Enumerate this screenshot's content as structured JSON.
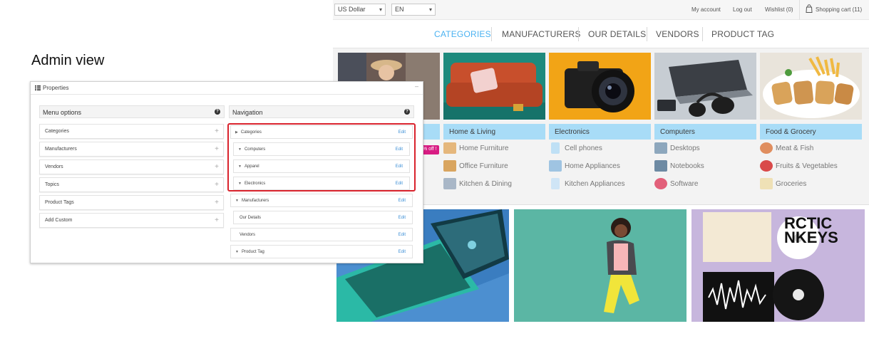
{
  "store": {
    "topbar": {
      "currency": "US Dollar",
      "language": "EN",
      "links": [
        "My account",
        "Log out",
        "Wishlist (0)",
        "Shopping cart (11)"
      ]
    },
    "nav": {
      "items": [
        "CATEGORIES",
        "MANUFACTURERS",
        "OUR DETAILS",
        "VENDORS",
        "PRODUCT TAG"
      ],
      "active_index": 0,
      "active_color": "#4ab2f1"
    },
    "promo_badge": "% off !",
    "mega_menu": [
      {
        "title": "",
        "items": []
      },
      {
        "title": "Home & Living",
        "items": [
          "Home Furniture",
          "Office Furniture",
          "Kitchen & Dining"
        ]
      },
      {
        "title": "Electronics",
        "items": [
          "Cell phones",
          "Home Appliances",
          "Kitchen Appliances"
        ]
      },
      {
        "title": "Computers",
        "items": [
          "Desktops",
          "Notebooks",
          "Software"
        ]
      },
      {
        "title": "Food & Grocery",
        "items": [
          "Meat & Fish",
          "Fruits & Vegetables",
          "Groceries"
        ]
      }
    ],
    "banners": [
      "tablet-phone-image",
      "jumping-woman-image",
      "vinyl-records-image"
    ],
    "record_text": "RCTIC\nNKEYS"
  },
  "admin": {
    "heading": "Admin view",
    "panel_title": "Properties",
    "menu_options": {
      "title": "Menu options",
      "items": [
        "Categories",
        "Manufacturers",
        "Vendors",
        "Topics",
        "Product Tags",
        "Add Custom"
      ]
    },
    "navigation": {
      "title": "Navigation",
      "edit_label": "Edit",
      "items": [
        {
          "label": "Categories",
          "level": 0,
          "toggle": "right"
        },
        {
          "label": "Computers",
          "level": 1,
          "toggle": "down"
        },
        {
          "label": "Apparel",
          "level": 1,
          "toggle": "down"
        },
        {
          "label": "Electronics",
          "level": 1,
          "toggle": "down"
        },
        {
          "label": "Manufacturers",
          "level": 0,
          "toggle": "down"
        },
        {
          "label": "Our Details",
          "level": 1,
          "toggle": "none"
        },
        {
          "label": "Vendors",
          "level": 0,
          "toggle": "none"
        },
        {
          "label": "Product Tag",
          "level": 0,
          "toggle": "down"
        }
      ],
      "highlight_color": "#d9232d"
    }
  }
}
